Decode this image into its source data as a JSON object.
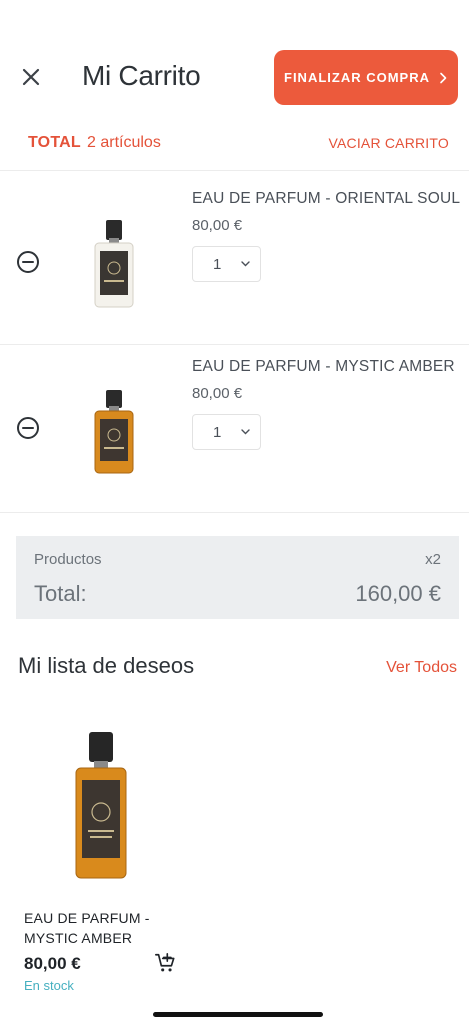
{
  "header": {
    "title": "Mi Carrito",
    "checkout_label": "FINALIZAR COMPRA",
    "close_icon": "close-icon",
    "chevron_icon": "chevron-right-icon"
  },
  "total_bar": {
    "label": "TOTAL",
    "count": "2 artículos",
    "empty_label": "VACIAR CARRITO"
  },
  "cart_items": [
    {
      "name": "EAU DE PARFUM - ORIENTAL SOUL",
      "price": "80,00 €",
      "quantity": "1",
      "bottle": "clear"
    },
    {
      "name": "EAU DE PARFUM - MYSTIC AMBER",
      "price": "80,00 €",
      "quantity": "1",
      "bottle": "amber"
    }
  ],
  "summary": {
    "products_label": "Productos",
    "products_qty": "x2",
    "total_label": "Total:",
    "total_value": "160,00 €"
  },
  "wishlist": {
    "title": "Mi lista de deseos",
    "see_all": "Ver Todos",
    "items": [
      {
        "name": "EAU DE PARFUM - MYSTIC AMBER",
        "price": "80,00 €",
        "stock": "En stock"
      }
    ]
  },
  "colors": {
    "accent": "#ec5a3c",
    "accent_text": "#e45239",
    "stock": "#46b0c0",
    "summary_bg": "#eceef0"
  }
}
